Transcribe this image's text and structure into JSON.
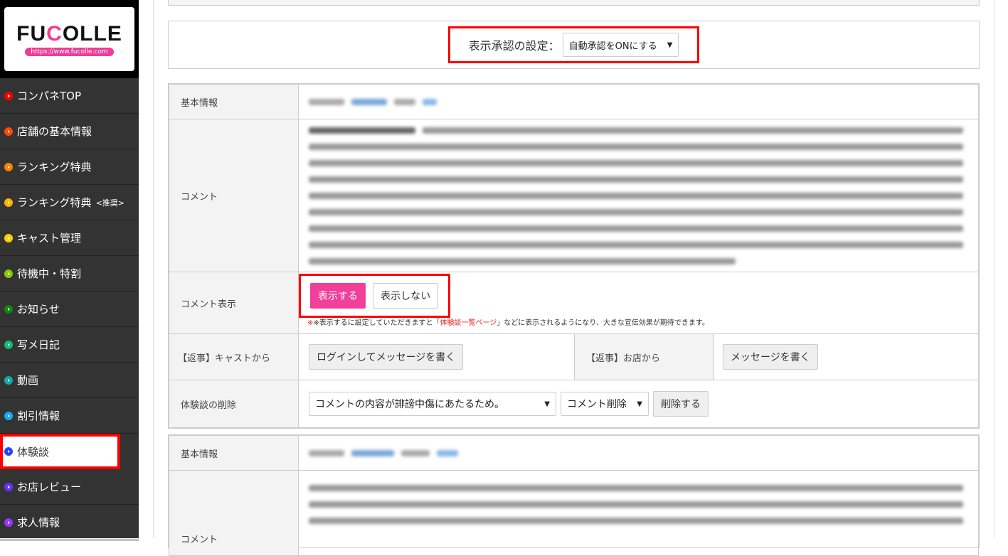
{
  "logo": {
    "brand": "FUCOLLE",
    "url": "https://www.fucolle.com"
  },
  "sidebar": {
    "items": [
      {
        "label": "コンパネTOP",
        "color": "#ff0000"
      },
      {
        "label": "店舗の基本情報",
        "color": "#ff4a00"
      },
      {
        "label": "ランキング特典",
        "color": "#ff7f00"
      },
      {
        "label": "ランキング特典",
        "suffix": "<推奨>",
        "color": "#ffb300"
      },
      {
        "label": "キャスト管理",
        "color": "#ffd000"
      },
      {
        "label": "待機中・特割",
        "color": "#88cc00"
      },
      {
        "label": "お知らせ",
        "color": "#118811"
      },
      {
        "label": "写メ日記",
        "color": "#11bb77"
      },
      {
        "label": "動画",
        "color": "#11aaaa"
      },
      {
        "label": "割引情報",
        "color": "#11aaff"
      },
      {
        "label": "体験談",
        "color": "#2244ff",
        "active": true
      },
      {
        "label": "お店レビュー",
        "color": "#6633ff"
      },
      {
        "label": "求人情報",
        "color": "#9933ff"
      }
    ]
  },
  "approval": {
    "label": "表示承認の設定：",
    "value": "自動承認をONにする"
  },
  "review": {
    "basic_label": "基本情報",
    "comment_label": "コメント",
    "display_label": "コメント表示",
    "show_button": "表示する",
    "hide_button": "表示しない",
    "note_prefix": "※表示するに設定していただきますと「",
    "note_link": "体験談一覧ページ",
    "note_suffix": "」などに表示されるようになり、大きな宣伝効果が期待できます。",
    "reply_cast_label": "【返事】キャストから",
    "reply_cast_button": "ログインしてメッセージを書く",
    "reply_shop_label": "【返事】お店から",
    "reply_shop_button": "メッセージを書く",
    "delete_label": "体験談の削除",
    "delete_reason": "コメントの内容が誹謗中傷にあたるため。",
    "delete_type": "コメント削除",
    "delete_button": "削除する"
  },
  "review2": {
    "basic_label": "基本情報",
    "comment_label": "コメント"
  }
}
